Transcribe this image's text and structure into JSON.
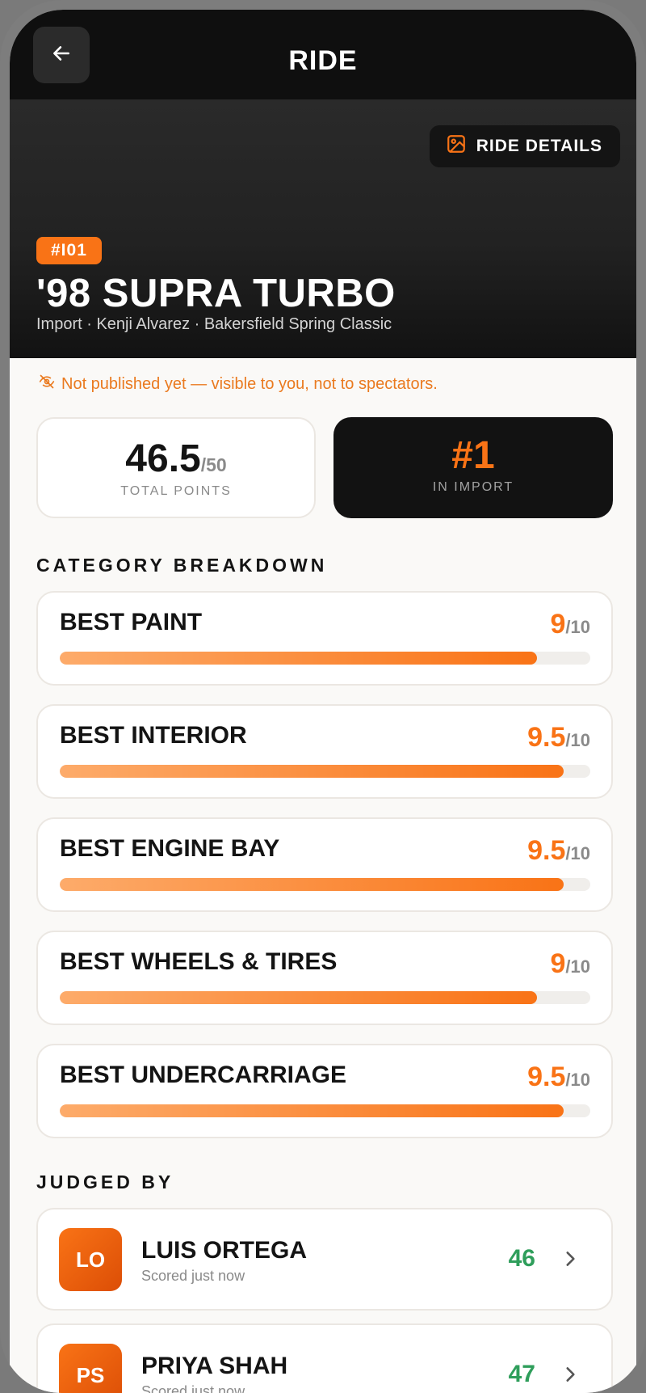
{
  "header": {
    "title": "RIDE",
    "back_icon": "arrow-left-icon"
  },
  "hero": {
    "details_button": "RIDE DETAILS",
    "details_icon": "image-icon",
    "number_badge": "#I01",
    "ride_name": "'98 SUPRA TURBO",
    "meta": "Import · Kenji Alvarez · Bakersfield Spring Classic"
  },
  "notice": {
    "icon": "eye-off-icon",
    "text": "Not published yet — visible to you, not to spectators."
  },
  "stats": {
    "total_points": "46.5",
    "total_max": "/50",
    "total_label": "TOTAL POINTS",
    "rank": "#1",
    "rank_label": "IN IMPORT"
  },
  "categories_heading": "CATEGORY BREAKDOWN",
  "categories": [
    {
      "name": "BEST PAINT",
      "score": "9",
      "max": "/10",
      "fraction": 0.9
    },
    {
      "name": "BEST INTERIOR",
      "score": "9.5",
      "max": "/10",
      "fraction": 0.95
    },
    {
      "name": "BEST ENGINE BAY",
      "score": "9.5",
      "max": "/10",
      "fraction": 0.95
    },
    {
      "name": "BEST WHEELS & TIRES",
      "score": "9",
      "max": "/10",
      "fraction": 0.9
    },
    {
      "name": "BEST UNDERCARRIAGE",
      "score": "9.5",
      "max": "/10",
      "fraction": 0.95
    }
  ],
  "judges_heading": "JUDGED BY",
  "judges": [
    {
      "initials": "LO",
      "name": "LUIS ORTEGA",
      "sub": "Scored just now",
      "score": "46"
    },
    {
      "initials": "PS",
      "name": "PRIYA SHAH",
      "sub": "Scored just now",
      "score": "47"
    }
  ],
  "colors": {
    "accent": "#f97316",
    "judge_score": "#2f9e5b",
    "dark": "#0f0f0f"
  }
}
